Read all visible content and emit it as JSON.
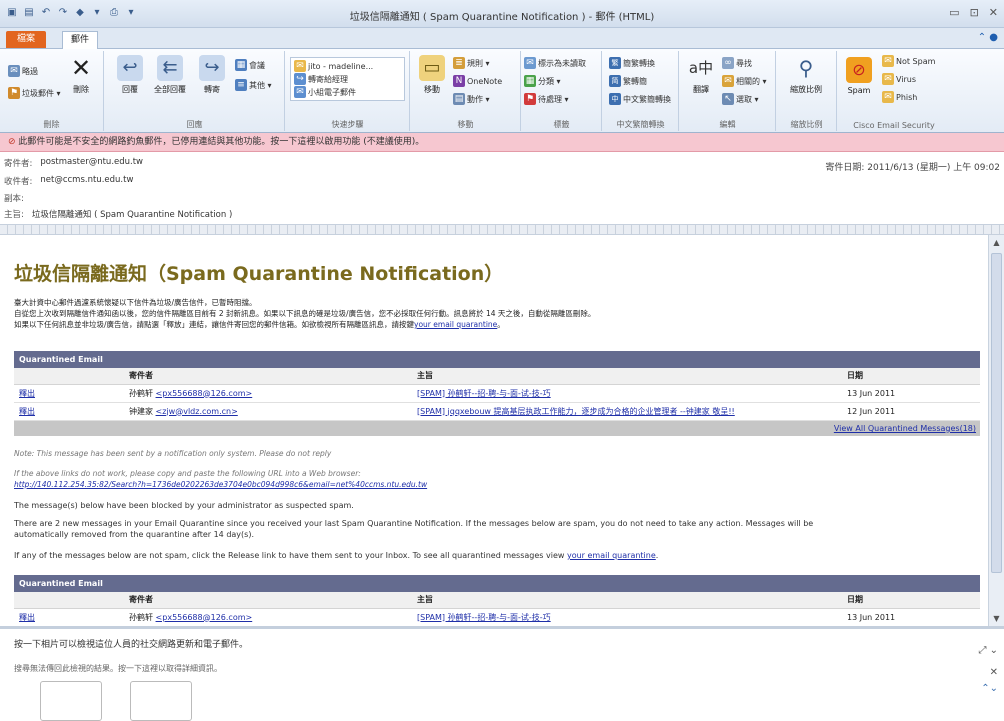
{
  "window": {
    "title": "垃圾信隔離通知 ( Spam Quarantine Notification ) - 郵件 (HTML)",
    "controls": [
      "▭",
      "⊡",
      "✕"
    ]
  },
  "tabs": {
    "file": "檔案",
    "message": "郵件"
  },
  "ribbon": {
    "delete_group": {
      "ignore": "略過",
      "junk": "垃圾郵件 ▾",
      "delete": "刪除",
      "label": "刪除"
    },
    "respond_group": {
      "reply": "回覆",
      "reply_all": "全部回覆",
      "forward": "轉寄",
      "meeting": "會議",
      "more": "其他 ▾",
      "label": "回應"
    },
    "quick_steps": {
      "items": [
        "jito - madeline...",
        "轉寄給經理",
        "小組電子郵件"
      ],
      "label": "快速步驟"
    },
    "move_group": {
      "move": "移動",
      "rules": "規則 ▾",
      "onenote": "OneNote",
      "actions": "動作 ▾",
      "label": "移動"
    },
    "tags_group": {
      "mark_unread": "標示為未讀取",
      "categorize": "分類 ▾",
      "follow_up": "待處理 ▾",
      "label": "標籤"
    },
    "chinese_group": {
      "to_trad": "簡繁轉換",
      "to_simp": "繁轉簡",
      "convert": "中文繁簡轉換",
      "label": "中文繁簡轉換"
    },
    "edit_group": {
      "translate": "翻譯",
      "find": "尋找",
      "related": "相關的 ▾",
      "select": "選取 ▾",
      "label": "編輯"
    },
    "zoom_group": {
      "zoom": "縮放比例",
      "label": "縮放比例"
    },
    "cisco_group": {
      "spam": "Spam",
      "not_spam": "Not Spam",
      "virus": "Virus",
      "phish": "Phish",
      "label": "Cisco Email Security"
    }
  },
  "warning": "此郵件可能是不安全的網路釣魚郵件，已停用連結與其他功能。按一下這裡以啟用功能 (不建議使用)。",
  "headers": {
    "from_label": "寄件者:",
    "from": "postmaster@ntu.edu.tw",
    "to_label": "收件者:",
    "to": "net@ccms.ntu.edu.tw",
    "cc_label": "副本:",
    "cc": "",
    "subject_label": "主旨:",
    "subject": "垃圾信隔離通知 ( Spam Quarantine Notification )",
    "date": "寄件日期:  2011/6/13 (星期一) 上午 09:02"
  },
  "body": {
    "heading": "垃圾信隔離通知（Spam Quarantine Notification）",
    "para1": "臺大計資中心郵件過濾系統懷疑以下信件為垃圾/廣告信件，已暫時阻擋。",
    "para2": "自從您上次收到隔離信件通知函以後，您的信件隔離區目前有 2 封新訊息。如果以下訊息的確是垃圾/廣告信，您不必採取任何行動。訊息將於 14 天之後，自動從隔離區刪除。",
    "para3": "如果以下任何訊息並非垃圾/廣告信，請點選「釋放」連結，讓信件寄回您的郵件信箱。如欲檢視所有隔離區訊息，請按鍵",
    "para3_link": "your email quarantine",
    "para3_end": "。",
    "table_title": "Quarantined Email",
    "col_from": "寄件者",
    "col_subject": "主旨",
    "col_date": "日期",
    "rows": [
      {
        "release": "釋出",
        "from_name": "孙鹤轩",
        "from_addr": "<px556688@126.com>",
        "subject": "[SPAM] 孙鹤轩--招-聘-与-面-试-技-巧",
        "date": "13 Jun 2011"
      },
      {
        "release": "釋出",
        "from_name": "钟建家",
        "from_addr": "<zjw@vldz.com.cn>",
        "subject": "[SPAM] jqqxebouw 提高基层执政工作能力，逐步成为合格的企业管理者 --钟建家 敬呈!!",
        "date": "12 Jun 2011"
      }
    ],
    "view_all": "View All Quarantined Messages(18)",
    "note1": "Note: This message has been sent by a notification only system. Please do not reply",
    "note2": "If the above links do not work, please copy and paste the following URL into a Web browser:",
    "url": "http://140.112.254.35:82/Search?h=1736de0202263de3704e0bc094d998c6&email=net%40ccms.ntu.edu.tw",
    "msg1": "The message(s) below have been blocked by your administrator as suspected spam.",
    "msg2a": "There are 2 new messages in your Email Quarantine since you received your last Spam Quarantine Notification. If the messages below are spam, you do not need to take any action. Messages will be",
    "msg2b": "automatically removed from the quarantine after 14 day(s).",
    "msg3": "If any of the messages below are not spam, click the Release link to have them sent to your Inbox. To see all quarantined messages view",
    "msg3_link": "your email quarantine",
    "msg3_end": ".",
    "table2_title": "Quarantined Email",
    "col2_from": "寄件者",
    "col2_subject": "主旨",
    "col2_date": "日期",
    "row2": {
      "release": "釋出",
      "from_name": "孙鹤轩",
      "from_addr": "<px556688@126.com>",
      "subject": "[SPAM] 孙鹤轩--招-聘-与-面-试-技-巧",
      "date": "13 Jun 2011"
    }
  },
  "social": {
    "title": "按一下相片可以檢視這位人員的社交網路更新和電子郵件。",
    "subtitle": "搜尋無法傳回此檢視的結果。按一下這裡以取得詳細資訊。"
  }
}
